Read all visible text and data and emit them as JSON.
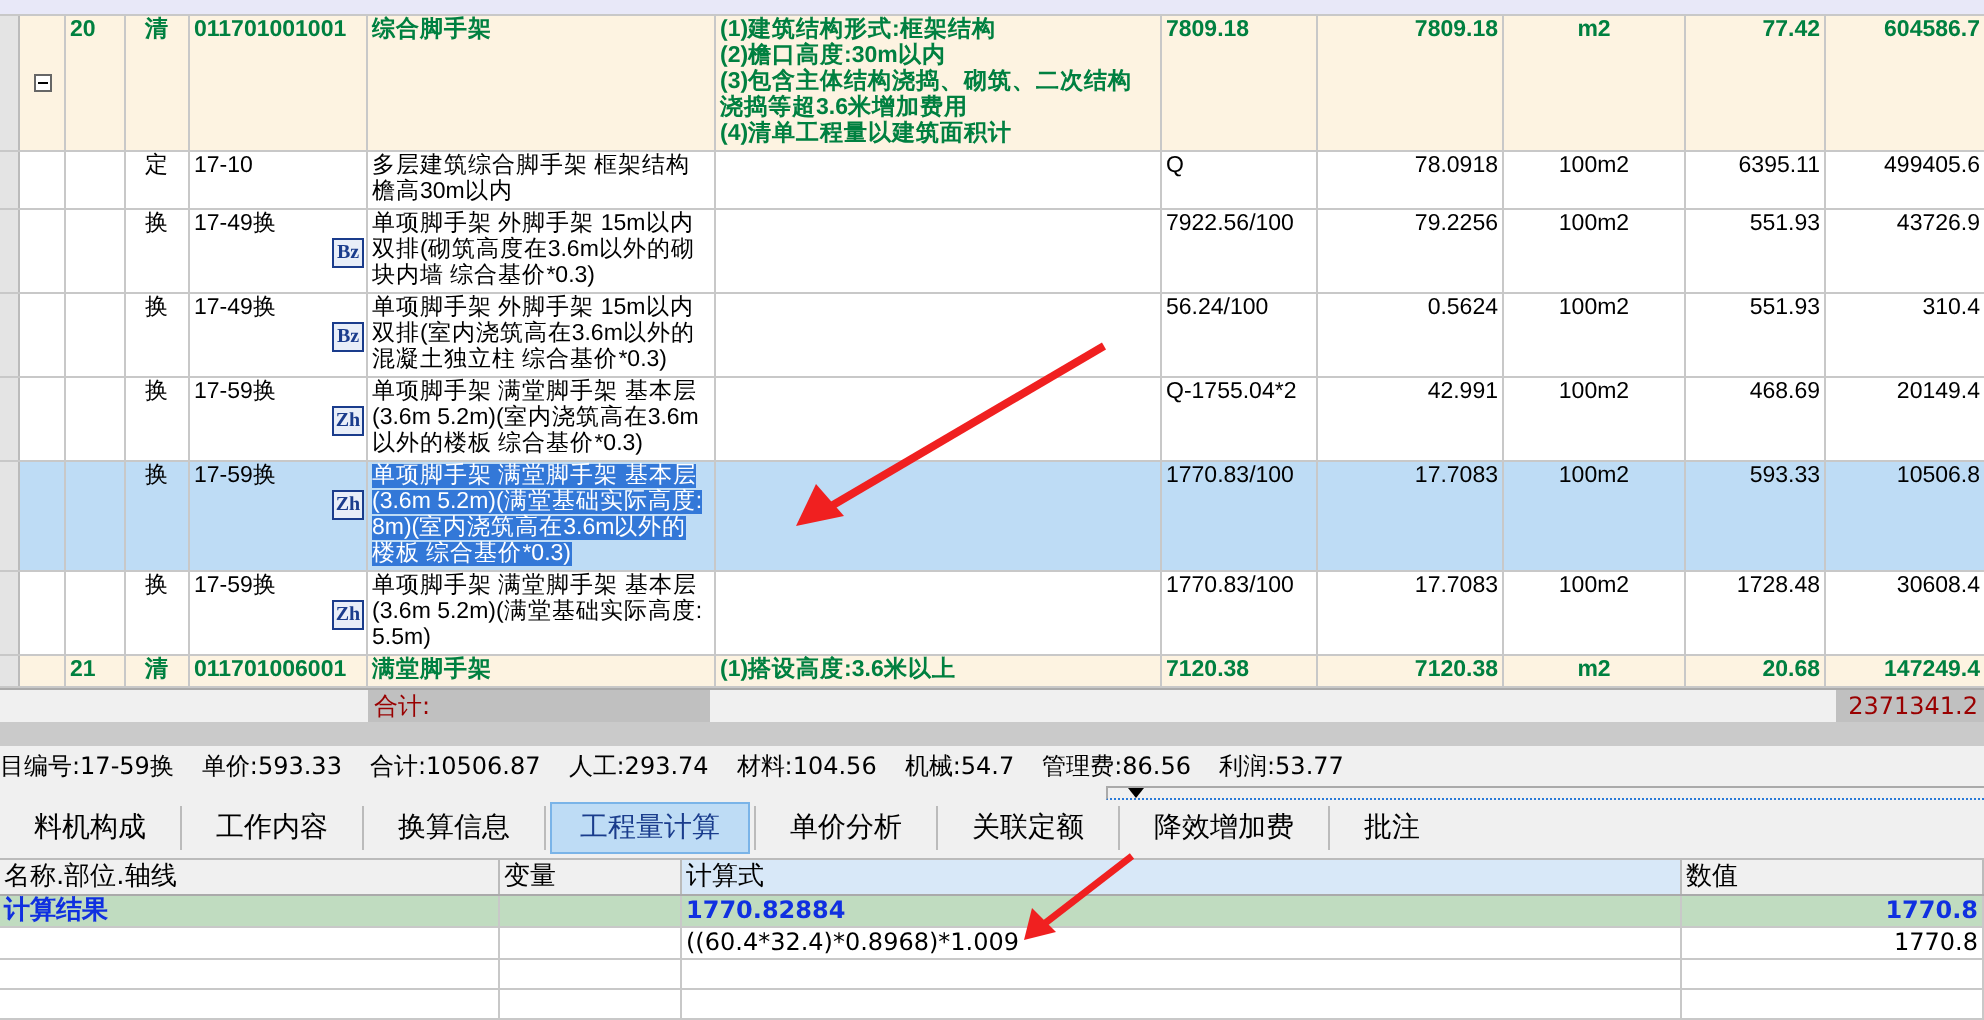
{
  "grid": {
    "rows": [
      {
        "kind": "bill",
        "expanded": true,
        "selected": false,
        "number": "20",
        "type": "清",
        "code": "011701001001",
        "name": "综合脚手架",
        "features": [
          "(1)建筑结构形式:框架结构",
          "(2)檐口高度:30m以内",
          "(3)包含主体结构浇捣、砌筑、二次结构浇捣等超3.6米增加费用",
          "(4)清单工程量以建筑面积计"
        ],
        "expression": "7809.18",
        "quantity": "7809.18",
        "unit": "m2",
        "unit_price": "77.42",
        "total": "604586.7"
      },
      {
        "kind": "quota",
        "selected": false,
        "type": "定",
        "code": "17-10",
        "name": "多层建筑综合脚手架 框架结构檐高30m以内",
        "expression": "Q",
        "quantity": "78.0918",
        "unit": "100m2",
        "unit_price": "6395.11",
        "total": "499405.6"
      },
      {
        "kind": "quota",
        "selected": false,
        "type": "换",
        "code": "17-49换",
        "badge": "Bz",
        "name": "单项脚手架 外脚手架 15m以内双排(砌筑高度在3.6m以外的砌块内墙 综合基价*0.3)",
        "expression": "7922.56/100",
        "quantity": "79.2256",
        "unit": "100m2",
        "unit_price": "551.93",
        "total": "43726.9"
      },
      {
        "kind": "quota",
        "selected": false,
        "type": "换",
        "code": "17-49换",
        "badge": "Bz",
        "name": "单项脚手架 外脚手架 15m以内双排(室内浇筑高在3.6m以外的混凝土独立柱 综合基价*0.3)",
        "expression": "56.24/100",
        "quantity": "0.5624",
        "unit": "100m2",
        "unit_price": "551.93",
        "total": "310.4"
      },
      {
        "kind": "quota",
        "selected": false,
        "type": "换",
        "code": "17-59换",
        "badge": "Zh",
        "name": "单项脚手架 满堂脚手架 基本层(3.6m 5.2m)(室内浇筑高在3.6m以外的楼板 综合基价*0.3)",
        "expression": "Q-1755.04*2",
        "quantity": "42.991",
        "unit": "100m2",
        "unit_price": "468.69",
        "total": "20149.4"
      },
      {
        "kind": "quota",
        "selected": true,
        "type": "换",
        "code": "17-59换",
        "badge": "Zh",
        "name": "单项脚手架 满堂脚手架 基本层(3.6m 5.2m)(满堂基础实际高度:8m)(室内浇筑高在3.6m以外的楼板 综合基价*0.3)",
        "expression": "1770.83/100",
        "quantity": "17.7083",
        "unit": "100m2",
        "unit_price": "593.33",
        "total": "10506.8"
      },
      {
        "kind": "quota",
        "selected": false,
        "type": "换",
        "code": "17-59换",
        "badge": "Zh",
        "name": "单项脚手架 满堂脚手架 基本层(3.6m 5.2m)(满堂基础实际高度:5.5m)",
        "expression": "1770.83/100",
        "quantity": "17.7083",
        "unit": "100m2",
        "unit_price": "1728.48",
        "total": "30608.4"
      },
      {
        "kind": "bill",
        "selected": false,
        "number": "21",
        "type": "清",
        "code": "011701006001",
        "name": "满堂脚手架",
        "features": [
          "(1)搭设高度:3.6米以上"
        ],
        "expression": "7120.38",
        "quantity": "7120.38",
        "unit": "m2",
        "unit_price": "20.68",
        "total": "147249.4"
      }
    ],
    "total_label": "合计:",
    "total_value": "2371341.2"
  },
  "info": [
    "目编号:17-59换",
    "单价:593.33",
    "合计:10506.87",
    "人工:293.74",
    "材料:104.56",
    "机械:54.7",
    "管理费:86.56",
    "利润:53.77"
  ],
  "tabs": [
    {
      "label": "料机构成",
      "selected": false
    },
    {
      "label": "工作内容",
      "selected": false
    },
    {
      "label": "换算信息",
      "selected": false
    },
    {
      "label": "工程量计算",
      "selected": true
    },
    {
      "label": "单价分析",
      "selected": false
    },
    {
      "label": "关联定额",
      "selected": false
    },
    {
      "label": "降效增加费",
      "selected": false
    },
    {
      "label": "批注",
      "selected": false
    }
  ],
  "calc": {
    "columns": [
      "名称.部位.轴线",
      "变量",
      "计算式",
      "数值"
    ],
    "rows": [
      {
        "kind": "result",
        "cells": [
          "计算结果",
          "",
          "1770.82884",
          "1770.8"
        ]
      },
      {
        "kind": "line",
        "cells": [
          "",
          "",
          "((60.4*32.4)*0.8968)*1.009",
          "1770.8"
        ]
      },
      {
        "kind": "empty",
        "cells": [
          "",
          "",
          "",
          ""
        ]
      },
      {
        "kind": "empty",
        "cells": [
          "",
          "",
          "",
          ""
        ]
      }
    ]
  }
}
